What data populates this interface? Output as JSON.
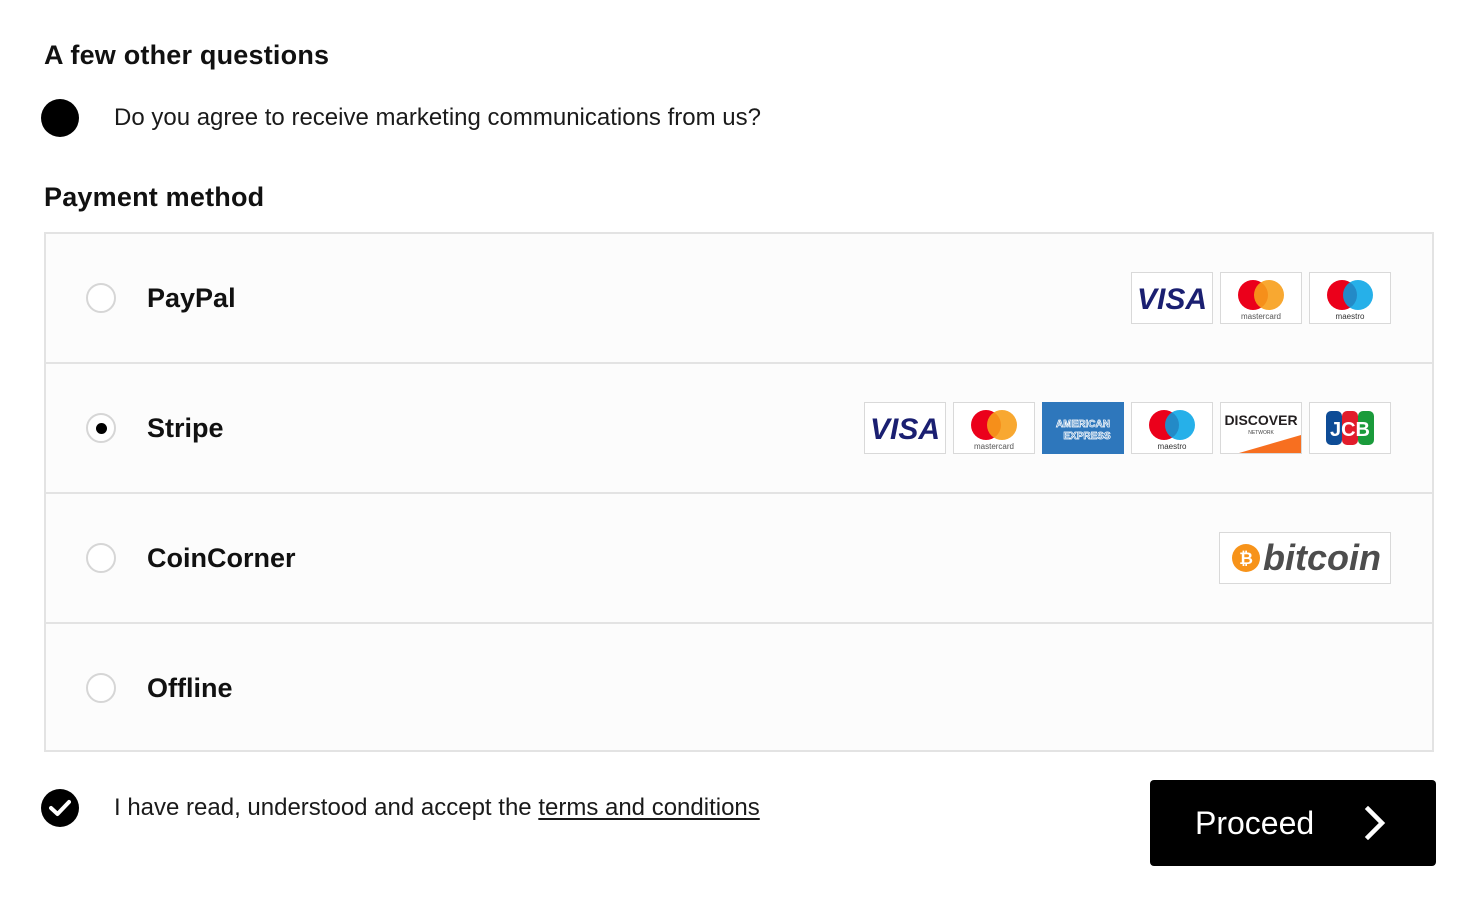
{
  "questions": {
    "heading": "A few other questions",
    "marketing_label": "Do you agree to receive marketing communications from us?"
  },
  "payment": {
    "heading": "Payment method",
    "methods": [
      {
        "name": "PayPal",
        "selected": false,
        "logos": [
          "visa",
          "mastercard",
          "maestro"
        ]
      },
      {
        "name": "Stripe",
        "selected": true,
        "logos": [
          "visa",
          "mastercard",
          "american-express",
          "maestro",
          "discover",
          "jcb"
        ]
      },
      {
        "name": "CoinCorner",
        "selected": false,
        "logos": [
          "bitcoin"
        ]
      },
      {
        "name": "Offline",
        "selected": false,
        "logos": []
      }
    ]
  },
  "logos": {
    "visa": "VISA",
    "mastercard": "mastercard",
    "maestro": "maestro",
    "amex_line1": "AMERICAN",
    "amex_line2": "EXPRESS",
    "discover": "DISCOVER",
    "discover_sub": "NETWORK",
    "jcb": "JCB",
    "bitcoin": "bitcoin"
  },
  "terms": {
    "prefix": "I have read, understood and accept the ",
    "link": "terms and conditions",
    "accepted": true
  },
  "actions": {
    "proceed": "Proceed"
  },
  "colors": {
    "visa_blue": "#1a1f71",
    "mc_red": "#eb001b",
    "mc_orange": "#f79e1b",
    "maestro_blue": "#00a2e5",
    "amex_blue": "#2e77bc",
    "discover_orange": "#f76f20",
    "bitcoin_orange": "#f7931a"
  }
}
